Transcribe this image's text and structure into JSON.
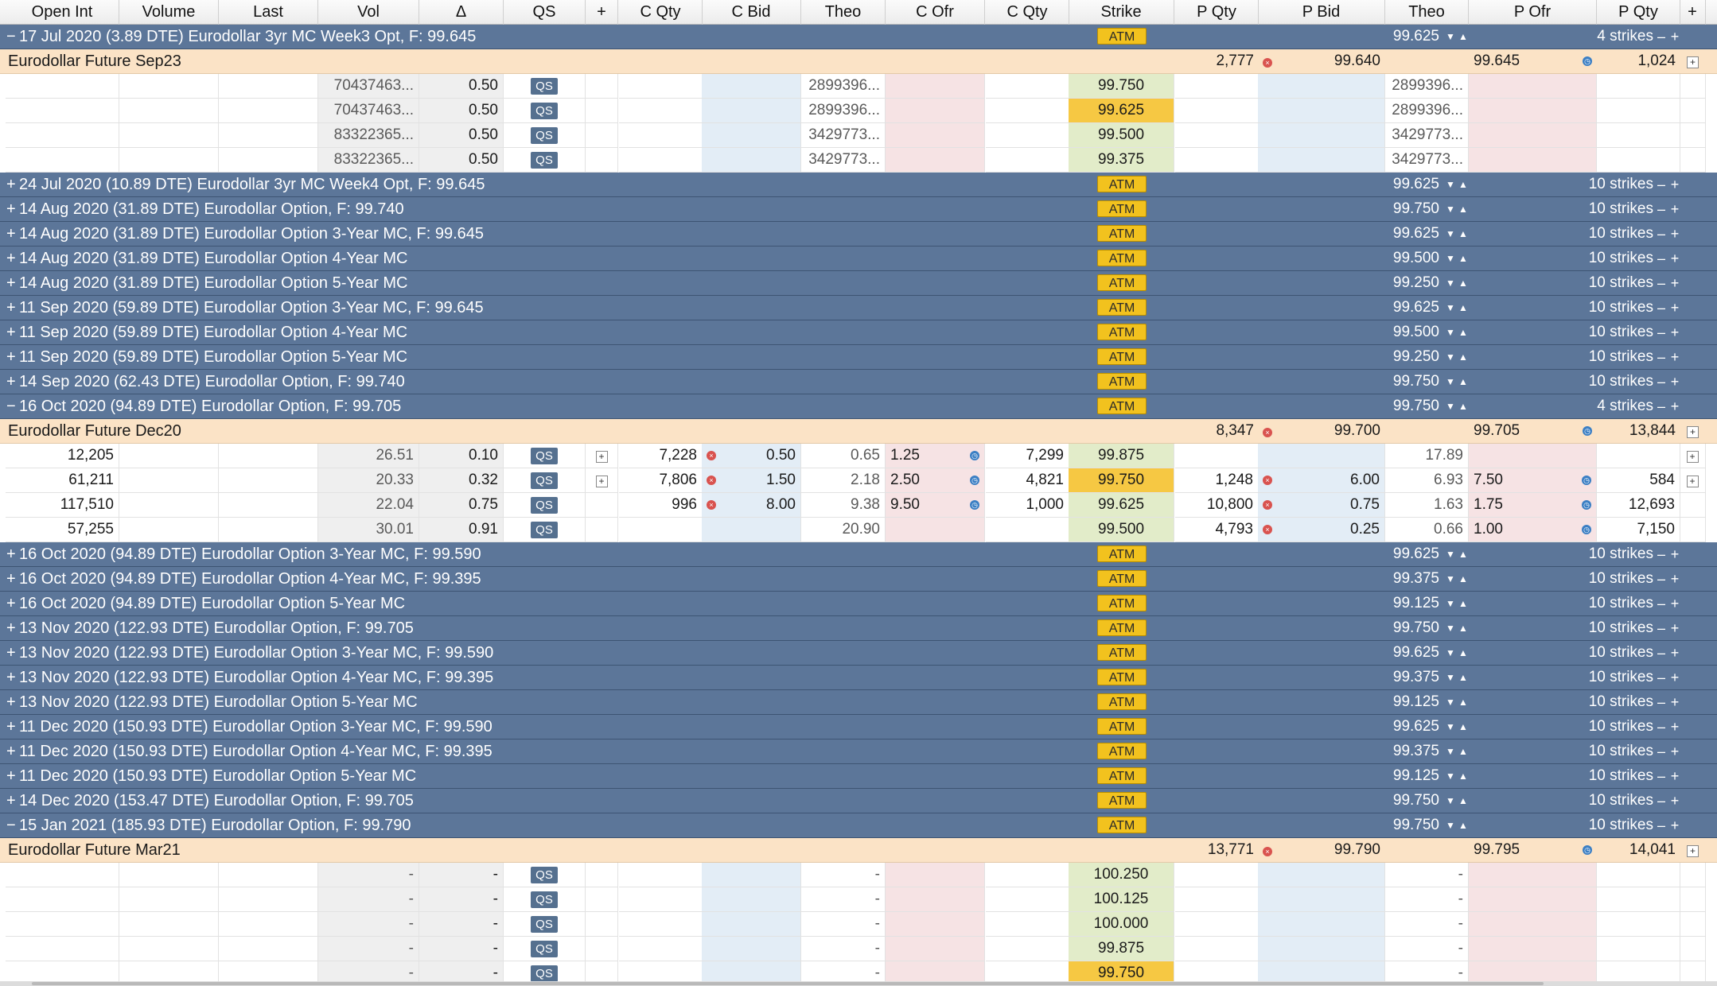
{
  "headers": [
    "Open Int",
    "Volume",
    "Last",
    "Vol",
    "Δ",
    "QS",
    "+",
    "C Qty",
    "C Bid",
    "Theo",
    "C Ofr",
    "C Qty",
    "Strike",
    "P Qty",
    "P Bid",
    "Theo",
    "P Ofr",
    "P Qty",
    "+"
  ],
  "rows": [
    {
      "kind": "series",
      "toggle": "−",
      "title": "17 Jul 2020 (3.89 DTE) Eurodollar 3yr MC Week3 Opt, F: 99.645",
      "atm": "ATM",
      "atm_strike": "99.625",
      "strikes": "4 strikes"
    },
    {
      "kind": "future",
      "name": "Eurodollar Future Sep23",
      "bid_qty": "2,777",
      "bid": "99.640",
      "ofr": "99.645",
      "ofr_qty": "1,024"
    },
    {
      "kind": "option",
      "cells": [
        "",
        "",
        "",
        "70437463...",
        "0.50",
        "QS",
        "",
        "",
        "",
        "2899396...",
        "",
        "",
        "99.750",
        "",
        "",
        "2899396...",
        "",
        "",
        ""
      ],
      "strike_style": "green"
    },
    {
      "kind": "option",
      "cells": [
        "",
        "",
        "",
        "70437463...",
        "0.50",
        "QS",
        "",
        "",
        "",
        "2899396...",
        "",
        "",
        "99.625",
        "",
        "",
        "2899396...",
        "",
        "",
        ""
      ],
      "strike_style": "atm"
    },
    {
      "kind": "option",
      "cells": [
        "",
        "",
        "",
        "83322365...",
        "0.50",
        "QS",
        "",
        "",
        "",
        "3429773...",
        "",
        "",
        "99.500",
        "",
        "",
        "3429773...",
        "",
        "",
        ""
      ],
      "strike_style": "green"
    },
    {
      "kind": "option",
      "cells": [
        "",
        "",
        "",
        "83322365...",
        "0.50",
        "QS",
        "",
        "",
        "",
        "3429773...",
        "",
        "",
        "99.375",
        "",
        "",
        "3429773...",
        "",
        "",
        ""
      ],
      "strike_style": "green"
    },
    {
      "kind": "series",
      "toggle": "+",
      "title": "24 Jul 2020 (10.89 DTE) Eurodollar 3yr MC Week4 Opt, F: 99.645",
      "atm": "ATM",
      "atm_strike": "99.625",
      "strikes": "10 strikes"
    },
    {
      "kind": "series",
      "toggle": "+",
      "title": "14 Aug 2020 (31.89 DTE) Eurodollar Option, F: 99.740",
      "atm": "ATM",
      "atm_strike": "99.750",
      "strikes": "10 strikes"
    },
    {
      "kind": "series",
      "toggle": "+",
      "title": "14 Aug 2020 (31.89 DTE) Eurodollar Option 3-Year MC, F: 99.645",
      "atm": "ATM",
      "atm_strike": "99.625",
      "strikes": "10 strikes"
    },
    {
      "kind": "series",
      "toggle": "+",
      "title": "14 Aug 2020 (31.89 DTE) Eurodollar Option 4-Year MC",
      "atm": "ATM",
      "atm_strike": "99.500",
      "strikes": "10 strikes"
    },
    {
      "kind": "series",
      "toggle": "+",
      "title": "14 Aug 2020 (31.89 DTE) Eurodollar Option 5-Year MC",
      "atm": "ATM",
      "atm_strike": "99.250",
      "strikes": "10 strikes"
    },
    {
      "kind": "series",
      "toggle": "+",
      "title": "11 Sep 2020 (59.89 DTE) Eurodollar Option 3-Year MC, F: 99.645",
      "atm": "ATM",
      "atm_strike": "99.625",
      "strikes": "10 strikes"
    },
    {
      "kind": "series",
      "toggle": "+",
      "title": "11 Sep 2020 (59.89 DTE) Eurodollar Option 4-Year MC",
      "atm": "ATM",
      "atm_strike": "99.500",
      "strikes": "10 strikes"
    },
    {
      "kind": "series",
      "toggle": "+",
      "title": "11 Sep 2020 (59.89 DTE) Eurodollar Option 5-Year MC",
      "atm": "ATM",
      "atm_strike": "99.250",
      "strikes": "10 strikes"
    },
    {
      "kind": "series",
      "toggle": "+",
      "title": "14 Sep 2020 (62.43 DTE) Eurodollar Option, F: 99.740",
      "atm": "ATM",
      "atm_strike": "99.750",
      "strikes": "10 strikes"
    },
    {
      "kind": "series",
      "toggle": "−",
      "title": "16 Oct 2020 (94.89 DTE) Eurodollar Option, F: 99.705",
      "atm": "ATM",
      "atm_strike": "99.750",
      "strikes": "4 strikes"
    },
    {
      "kind": "future",
      "name": "Eurodollar Future Dec20",
      "bid_qty": "8,347",
      "bid": "99.700",
      "ofr": "99.705",
      "ofr_qty": "13,844"
    },
    {
      "kind": "option",
      "cells": [
        "12,205",
        "",
        "",
        "26.51",
        "0.10",
        "QS",
        "+",
        "7,228",
        "0.50",
        "0.65",
        "1.25",
        "7,299",
        "99.875",
        "",
        "",
        "17.89",
        "",
        "",
        ""
      ],
      "strike_style": "green",
      "put_plus": true,
      "c_icons": true,
      "p_icons": false
    },
    {
      "kind": "option",
      "cells": [
        "61,211",
        "",
        "",
        "20.33",
        "0.32",
        "QS",
        "+",
        "7,806",
        "1.50",
        "2.18",
        "2.50",
        "4,821",
        "99.750",
        "1,248",
        "6.00",
        "6.93",
        "7.50",
        "584",
        ""
      ],
      "strike_style": "atm",
      "put_plus": true,
      "c_icons": true,
      "p_icons": true
    },
    {
      "kind": "option",
      "cells": [
        "117,510",
        "",
        "",
        "22.04",
        "0.75",
        "QS",
        "",
        "996",
        "8.00",
        "9.38",
        "9.50",
        "1,000",
        "99.625",
        "10,800",
        "0.75",
        "1.63",
        "1.75",
        "12,693",
        ""
      ],
      "strike_style": "green",
      "c_icons": true,
      "p_icons": true
    },
    {
      "kind": "option",
      "cells": [
        "57,255",
        "",
        "",
        "30.01",
        "0.91",
        "QS",
        "",
        "",
        "",
        "20.90",
        "",
        "",
        "99.500",
        "4,793",
        "0.25",
        "0.66",
        "1.00",
        "7,150",
        ""
      ],
      "strike_style": "green",
      "c_icons": false,
      "p_icons": true
    },
    {
      "kind": "series",
      "toggle": "+",
      "title": "16 Oct 2020 (94.89 DTE) Eurodollar Option 3-Year MC, F: 99.590",
      "atm": "ATM",
      "atm_strike": "99.625",
      "strikes": "10 strikes"
    },
    {
      "kind": "series",
      "toggle": "+",
      "title": "16 Oct 2020 (94.89 DTE) Eurodollar Option 4-Year MC, F: 99.395",
      "atm": "ATM",
      "atm_strike": "99.375",
      "strikes": "10 strikes"
    },
    {
      "kind": "series",
      "toggle": "+",
      "title": "16 Oct 2020 (94.89 DTE) Eurodollar Option 5-Year MC",
      "atm": "ATM",
      "atm_strike": "99.125",
      "strikes": "10 strikes"
    },
    {
      "kind": "series",
      "toggle": "+",
      "title": "13 Nov 2020 (122.93 DTE) Eurodollar Option, F: 99.705",
      "atm": "ATM",
      "atm_strike": "99.750",
      "strikes": "10 strikes"
    },
    {
      "kind": "series",
      "toggle": "+",
      "title": "13 Nov 2020 (122.93 DTE) Eurodollar Option 3-Year MC, F: 99.590",
      "atm": "ATM",
      "atm_strike": "99.625",
      "strikes": "10 strikes"
    },
    {
      "kind": "series",
      "toggle": "+",
      "title": "13 Nov 2020 (122.93 DTE) Eurodollar Option 4-Year MC, F: 99.395",
      "atm": "ATM",
      "atm_strike": "99.375",
      "strikes": "10 strikes"
    },
    {
      "kind": "series",
      "toggle": "+",
      "title": "13 Nov 2020 (122.93 DTE) Eurodollar Option 5-Year MC",
      "atm": "ATM",
      "atm_strike": "99.125",
      "strikes": "10 strikes"
    },
    {
      "kind": "series",
      "toggle": "+",
      "title": "11 Dec 2020 (150.93 DTE) Eurodollar Option 3-Year MC, F: 99.590",
      "atm": "ATM",
      "atm_strike": "99.625",
      "strikes": "10 strikes"
    },
    {
      "kind": "series",
      "toggle": "+",
      "title": "11 Dec 2020 (150.93 DTE) Eurodollar Option 4-Year MC, F: 99.395",
      "atm": "ATM",
      "atm_strike": "99.375",
      "strikes": "10 strikes"
    },
    {
      "kind": "series",
      "toggle": "+",
      "title": "11 Dec 2020 (150.93 DTE) Eurodollar Option 5-Year MC",
      "atm": "ATM",
      "atm_strike": "99.125",
      "strikes": "10 strikes"
    },
    {
      "kind": "series",
      "toggle": "+",
      "title": "14 Dec 2020 (153.47 DTE) Eurodollar Option, F: 99.705",
      "atm": "ATM",
      "atm_strike": "99.750",
      "strikes": "10 strikes"
    },
    {
      "kind": "series",
      "toggle": "−",
      "title": "15 Jan 2021 (185.93 DTE) Eurodollar Option, F: 99.790",
      "atm": "ATM",
      "atm_strike": "99.750",
      "strikes": "10 strikes"
    },
    {
      "kind": "future",
      "name": "Eurodollar Future Mar21",
      "bid_qty": "13,771",
      "bid": "99.790",
      "ofr": "99.795",
      "ofr_qty": "14,041"
    },
    {
      "kind": "option",
      "cells": [
        "",
        "",
        "",
        "-",
        "-",
        "QS",
        "",
        "",
        "",
        "-",
        "",
        "",
        "100.250",
        "",
        "",
        "-",
        "",
        "",
        ""
      ],
      "strike_style": "green"
    },
    {
      "kind": "option",
      "cells": [
        "",
        "",
        "",
        "-",
        "-",
        "QS",
        "",
        "",
        "",
        "-",
        "",
        "",
        "100.125",
        "",
        "",
        "-",
        "",
        "",
        ""
      ],
      "strike_style": "green"
    },
    {
      "kind": "option",
      "cells": [
        "",
        "",
        "",
        "-",
        "-",
        "QS",
        "",
        "",
        "",
        "-",
        "",
        "",
        "100.000",
        "",
        "",
        "-",
        "",
        "",
        ""
      ],
      "strike_style": "green"
    },
    {
      "kind": "option",
      "cells": [
        "",
        "",
        "",
        "-",
        "-",
        "QS",
        "",
        "",
        "",
        "-",
        "",
        "",
        "99.875",
        "",
        "",
        "-",
        "",
        "",
        ""
      ],
      "strike_style": "green"
    },
    {
      "kind": "option",
      "cells": [
        "",
        "",
        "",
        "-",
        "-",
        "QS",
        "",
        "",
        "",
        "-",
        "",
        "",
        "99.750",
        "",
        "",
        "-",
        "",
        "",
        ""
      ],
      "strike_style": "atm"
    }
  ],
  "icons": {
    "call_bid": "cancel-icon",
    "call_ofr": "clock-icon",
    "put_bid": "cancel-icon",
    "put_ofr": "clock-icon",
    "arrows": "down-up-arrows-icon"
  },
  "colors": {
    "series_bar": "#5c7699",
    "future_row": "#fbe3c6",
    "atm_badge": "#f2c21e",
    "atm_strike": "#f6c843",
    "strike_cell": "#e2ecc9",
    "bid_col": "#e3edf6",
    "ofr_col": "#f6e3e4",
    "vol_col": "#efefef"
  }
}
